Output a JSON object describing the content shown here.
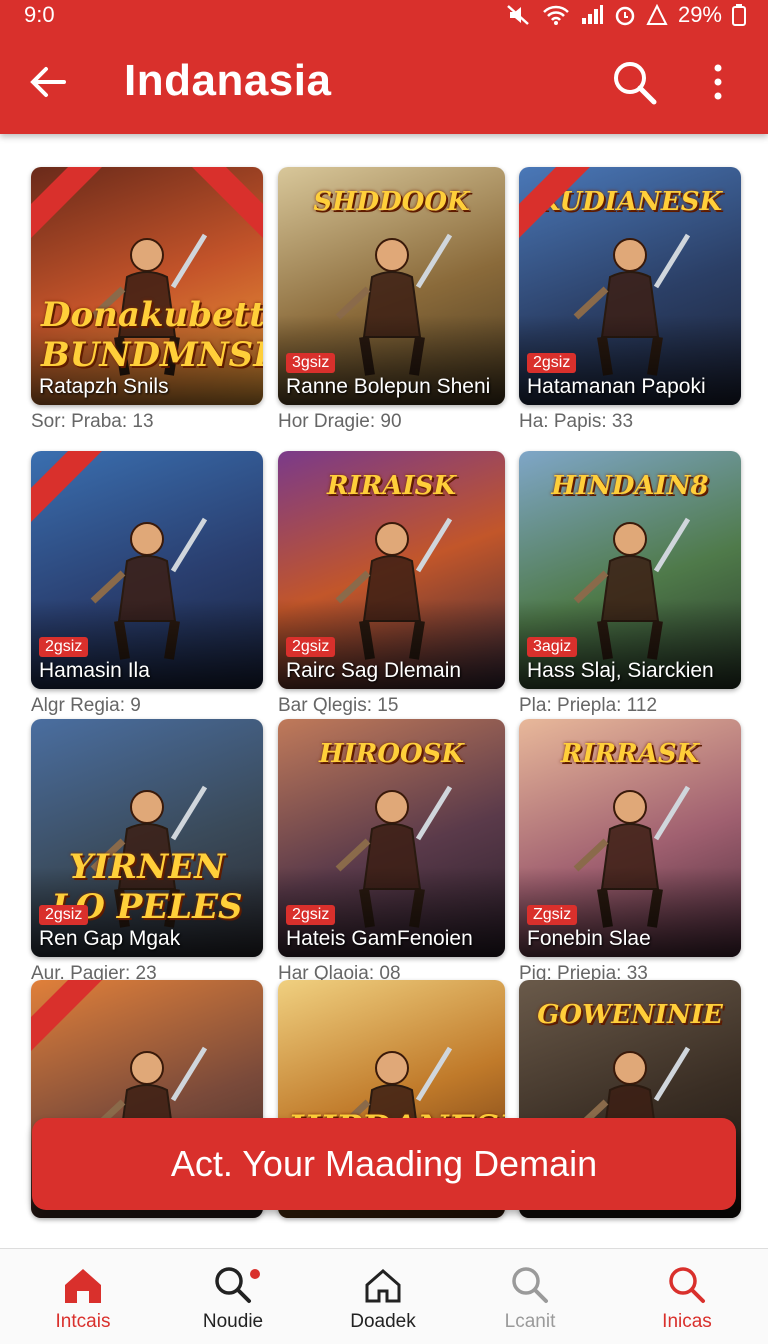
{
  "status_bar": {
    "time": "9:0",
    "battery": "29%"
  },
  "app_bar": {
    "title": "Indanasia"
  },
  "colors": {
    "accent": "#d9302c",
    "background": "#ffffff"
  },
  "games": [
    {
      "logo": "Donakubett BUNDMNSEH",
      "tag": "",
      "name": "Ratapzh Snils",
      "meta": "Sor: Praba: 13",
      "bg": "linear-gradient(160deg,#6a2a1a,#c4542a 50%,#f0a23a)"
    },
    {
      "logo": "SHDDOOK",
      "tag": "3gsiz",
      "name": "Ranne Bolepun Sheni",
      "meta": "Hor Dragie: 90",
      "bg": "linear-gradient(160deg,#d8c79a,#8a6a3a 55%,#4a3a20)"
    },
    {
      "logo": "KUDIANESK",
      "tag": "2gsiz",
      "name": "Hatamanan Papoki",
      "meta": "Ha: Papis: 33",
      "bg": "linear-gradient(160deg,#4a78b8,#2b3f66 55%,#1c2236)"
    },
    {
      "logo": "",
      "tag": "2gsiz",
      "name": "Hamasin Ila",
      "meta": "Algr Regia: 9",
      "bg": "linear-gradient(160deg,#3a6fb0,#2a3f70 55%,#1a2440)"
    },
    {
      "logo": "RIRAISK",
      "tag": "2gsiz",
      "name": "Rairc Sag Dlemain",
      "meta": "Bar Qlegis: 15",
      "bg": "linear-gradient(160deg,#7a3a8a,#c2562a 50%,#3a2a3a)"
    },
    {
      "logo": "HINDAIN8",
      "tag": "3agiz",
      "name": "Hass Slaj, Siarckien",
      "meta": "Pla: Priepla: 112",
      "bg": "linear-gradient(160deg,#7fa6c8,#4f7a4a 55%,#2a3a2a)"
    },
    {
      "logo": "YIRNEN LO PELES",
      "tag": "2gsiz",
      "name": "Ren Gap Mgak",
      "meta": "Aur. Pagier: 23",
      "bg": "linear-gradient(160deg,#4a6ea0,#3a4a5a 55%,#2a2a30)"
    },
    {
      "logo": "HIROOSK",
      "tag": "2gsiz",
      "name": "Hateis GamFenoien",
      "meta": "Har Qlaoia: 08",
      "bg": "linear-gradient(160deg,#c07a5a,#5a3a4a 55%,#2a1e2a)"
    },
    {
      "logo": "RIRRASK",
      "tag": "Zgsiz",
      "name": "Fonebin Slae",
      "meta": "Pig: Priepia: 33",
      "bg": "linear-gradient(160deg,#e8b89a,#a06070 55%,#4a2a3a)"
    },
    {
      "logo": "",
      "tag": "",
      "name": "",
      "meta": "",
      "bg": "linear-gradient(160deg,#e0803a,#7a4a3a 55%,#3a2a2a)"
    },
    {
      "logo": "HIPDANESH",
      "tag": "",
      "name": "",
      "meta": "",
      "bg": "linear-gradient(160deg,#f0d080,#c07a2a 50%,#5a2a10)"
    },
    {
      "logo": "GOWENINIE",
      "tag": "",
      "name": "",
      "meta": "",
      "bg": "linear-gradient(160deg,#6a5a4a,#3a2e24 55%,#1a1410)"
    }
  ],
  "cta": {
    "label": "Act.  Your Maading Demain"
  },
  "bottom_nav": [
    {
      "label": "Intcais",
      "icon": "home-icon",
      "active": true
    },
    {
      "label": "Noudie",
      "icon": "search-icon",
      "active": false
    },
    {
      "label": "Doadek",
      "icon": "home-outline-icon",
      "active": false
    },
    {
      "label": "Lcanit",
      "icon": "search-icon",
      "active": false
    },
    {
      "label": "Inicas",
      "icon": "search-icon",
      "active": true
    }
  ]
}
